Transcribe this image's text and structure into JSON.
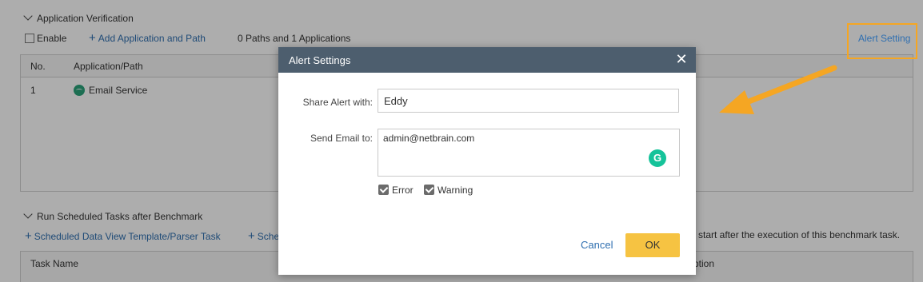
{
  "app_verification": {
    "section_title": "Application Verification",
    "enable_label": "Enable",
    "add_link_label": "Add Application and Path",
    "count_text": "0 Paths and 1 Applications",
    "alert_setting_link": "Alert Setting",
    "table": {
      "columns": [
        "No.",
        "Application/Path"
      ],
      "rows": [
        {
          "no": "1",
          "name": "Email Service"
        }
      ]
    }
  },
  "scheduled_tasks": {
    "section_title": "Run Scheduled Tasks after Benchmark",
    "add_template_link": "Scheduled Data View Template/Parser Task",
    "add_other_link_partial": "Sche",
    "note_partial": "start after the execution of this benchmark task.",
    "table_headers": [
      "Task Name",
      "ption"
    ]
  },
  "dialog": {
    "title": "Alert Settings",
    "share_label": "Share Alert with:",
    "share_value": "Eddy",
    "email_label": "Send Email to:",
    "email_value": "admin@netbrain.com",
    "checkboxes": [
      {
        "label": "Error",
        "checked": true
      },
      {
        "label": "Warning",
        "checked": true
      }
    ],
    "cancel_label": "Cancel",
    "ok_label": "OK"
  },
  "colors": {
    "header_bg": "#4d5e6e",
    "ok_button": "#f6c342",
    "link": "#2f6fb0",
    "highlight": "#f5a623",
    "grammarly": "#15c39a"
  }
}
